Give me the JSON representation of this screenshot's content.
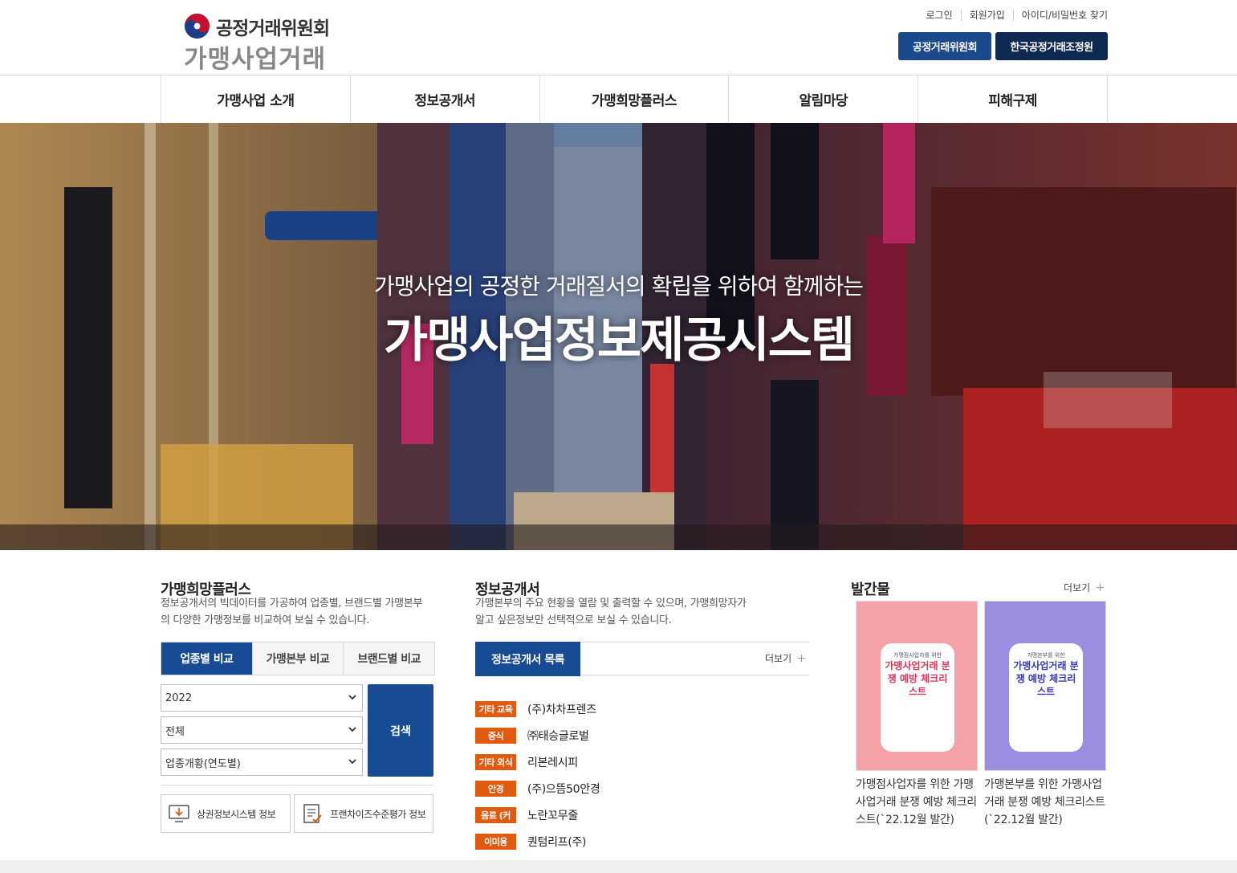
{
  "header": {
    "org_name": "공정거래위원회",
    "service_name": "가맹사업거래",
    "util_links": [
      "로그인",
      "회원가입",
      "아이디/비밀번호 찾기"
    ],
    "org_buttons": [
      "공정거래위원회",
      "한국공정거래조정원"
    ]
  },
  "nav": [
    "가맹사업 소개",
    "정보공개서",
    "가맹희망플러스",
    "알림마당",
    "피해구제"
  ],
  "hero": {
    "subtitle": "가맹사업의 공정한 거래질서의 확립을 위하여 함께하는",
    "title": "가맹사업정보제공시스템"
  },
  "plus": {
    "title": "가맹희망플러스",
    "desc_line1": "정보공개서의 빅데이터를 가공하여 업종별, 브랜드별 가맹본부",
    "desc_line2": "의 다양한 가맹정보를 비교하여 보실 수 있습니다.",
    "tabs": [
      "업종별 비교",
      "가맹본부 비교",
      "브랜드별 비교"
    ],
    "select_year": "2022",
    "select_type": "전체",
    "select_report": "업종개황(연도별)",
    "search_label": "검색",
    "link1": "상권정보시스템 정보",
    "link2": "프랜차이즈수준평가 정보"
  },
  "disclosure": {
    "title": "정보공개서",
    "desc_line1": "가맹본부의 주요 현황을 열람 및 출력할 수 있으며, 가맹희망자가",
    "desc_line2": "알고 싶은정보만 선택적으로 보실 수 있습니다.",
    "tab_label": "정보공개서 목록",
    "more_label": "더보기",
    "items": [
      {
        "category": "기타 교육",
        "name": "(주)차차프렌즈"
      },
      {
        "category": "중식",
        "name": "㈜태승글로벌"
      },
      {
        "category": "기타 외식",
        "name": "리본레시피"
      },
      {
        "category": "안경",
        "name": "(주)으뜸50안경"
      },
      {
        "category": "음료 (커",
        "name": "노란꼬무줄"
      },
      {
        "category": "이미용",
        "name": "퀀텀리프(주)"
      }
    ],
    "badge_color": "#e05a10"
  },
  "publications": {
    "title": "발간물",
    "more_label": "더보기",
    "items": [
      {
        "caption": "가맹점사업자를 위한 가맹사업거래 분쟁 예방 체크리스트(`22.12월 발간)",
        "cover_small": "가맹점사업자를 위한",
        "cover_title": "가맹사업거래 분쟁 예방 체크리스트",
        "cover_color": "#f4a2a8"
      },
      {
        "caption": "가맹본부를 위한 가맹사업거래 분쟁 예방 체크리스트(`22.12월 발간)",
        "cover_small": "가맹본부를 위한",
        "cover_title": "가맹사업거래 분쟁 예방 체크리스트",
        "cover_color": "#9b8ee0"
      }
    ]
  },
  "colors": {
    "primary": "#174b93",
    "dark_navy": "#0e2a52",
    "accent_orange": "#e05a10"
  }
}
